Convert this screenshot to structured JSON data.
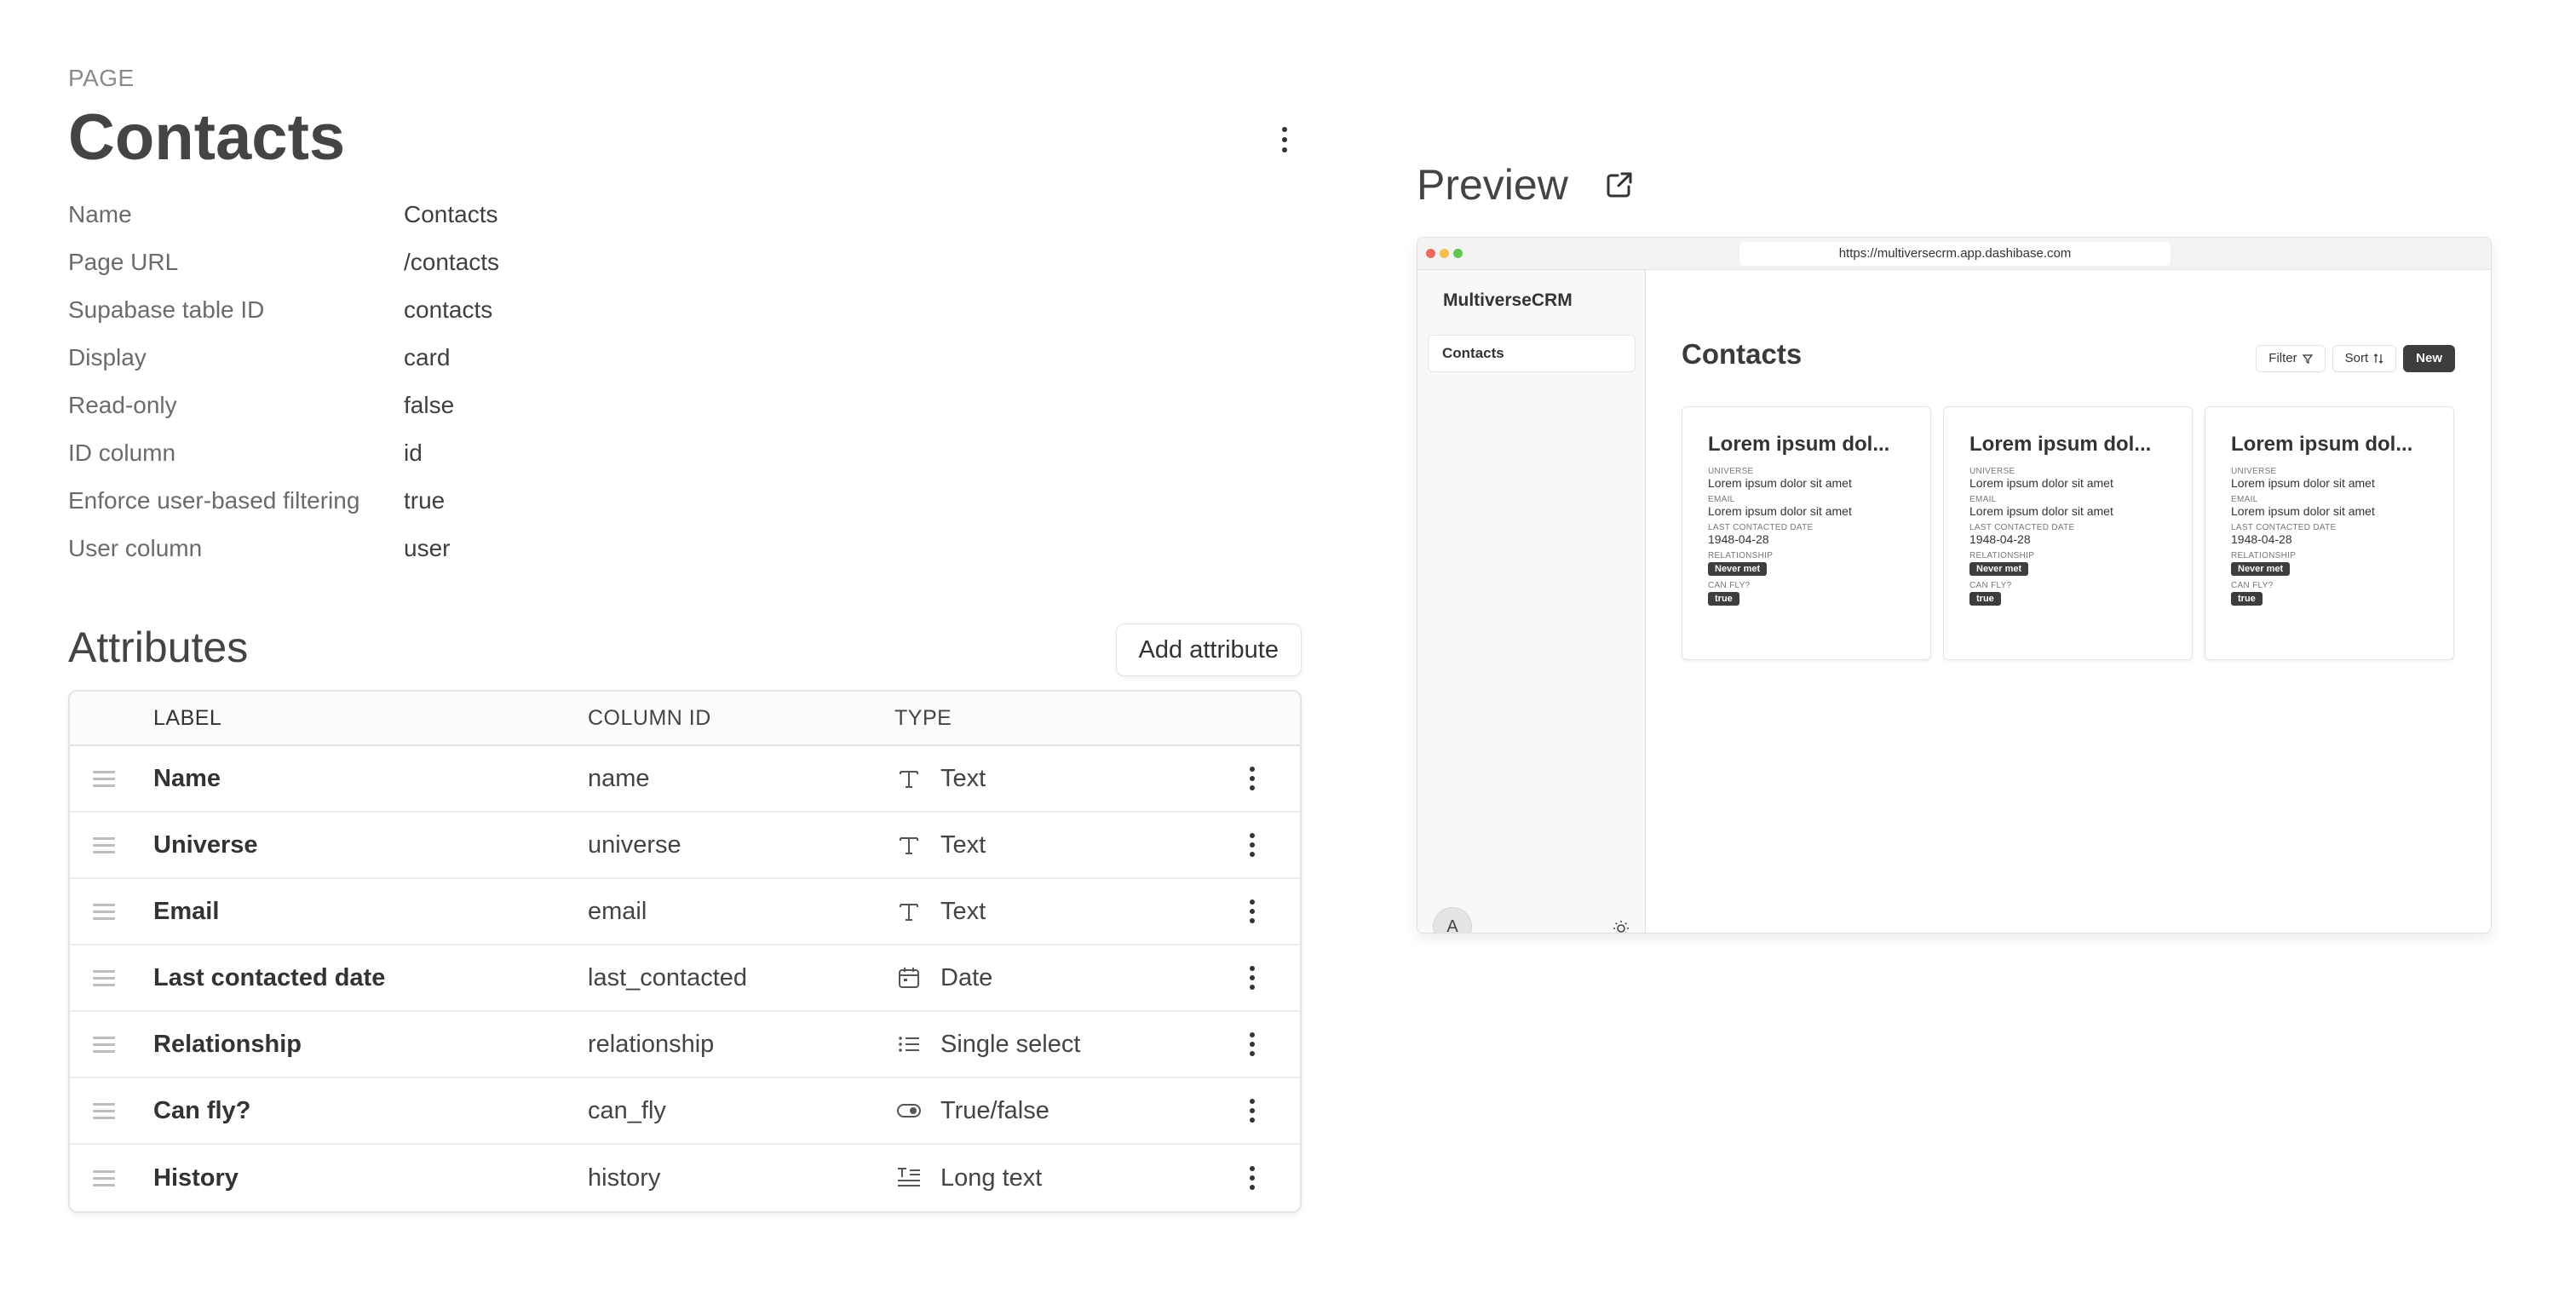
{
  "page": {
    "eyebrow": "PAGE",
    "title": "Contacts"
  },
  "properties": [
    {
      "key": "Name",
      "value": "Contacts"
    },
    {
      "key": "Page URL",
      "value": "/contacts"
    },
    {
      "key": "Supabase table ID",
      "value": "contacts"
    },
    {
      "key": "Display",
      "value": "card"
    },
    {
      "key": "Read-only",
      "value": "false"
    },
    {
      "key": "ID column",
      "value": "id"
    },
    {
      "key": "Enforce user-based filtering",
      "value": "true"
    },
    {
      "key": "User column",
      "value": "user"
    }
  ],
  "attributes": {
    "title": "Attributes",
    "add_label": "Add attribute",
    "columns": {
      "label": "LABEL",
      "column_id": "COLUMN ID",
      "type": "TYPE"
    },
    "rows": [
      {
        "label": "Name",
        "column_id": "name",
        "type": "Text",
        "icon": "text-type-icon"
      },
      {
        "label": "Universe",
        "column_id": "universe",
        "type": "Text",
        "icon": "text-type-icon"
      },
      {
        "label": "Email",
        "column_id": "email",
        "type": "Text",
        "icon": "text-type-icon"
      },
      {
        "label": "Last contacted date",
        "column_id": "last_contacted",
        "type": "Date",
        "icon": "calendar-icon"
      },
      {
        "label": "Relationship",
        "column_id": "relationship",
        "type": "Single select",
        "icon": "list-icon"
      },
      {
        "label": "Can fly?",
        "column_id": "can_fly",
        "type": "True/false",
        "icon": "toggle-icon"
      },
      {
        "label": "History",
        "column_id": "history",
        "type": "Long text",
        "icon": "long-text-icon"
      }
    ]
  },
  "preview": {
    "title": "Preview",
    "url": "https://multiversecrm.app.dashibase.com",
    "traffic_lights": [
      "#ed6a5e",
      "#f5bf4f",
      "#61c554"
    ],
    "app_name": "MultiverseCRM",
    "nav_item": "Contacts",
    "avatar_initial": "A",
    "main_title": "Contacts",
    "filter_label": "Filter",
    "sort_label": "Sort",
    "new_label": "New",
    "cards": [
      {
        "title": "Lorem ipsum dol...",
        "fields": [
          {
            "label": "UNIVERSE",
            "value": "Lorem ipsum dolor sit amet"
          },
          {
            "label": "EMAIL",
            "value": "Lorem ipsum dolor sit amet"
          },
          {
            "label": "LAST CONTACTED DATE",
            "value": "1948-04-28"
          }
        ],
        "relationship_label": "RELATIONSHIP",
        "relationship": "Never met",
        "fly_label": "CAN FLY?",
        "fly": "true"
      },
      {
        "title": "Lorem ipsum dol...",
        "fields": [
          {
            "label": "UNIVERSE",
            "value": "Lorem ipsum dolor sit amet"
          },
          {
            "label": "EMAIL",
            "value": "Lorem ipsum dolor sit amet"
          },
          {
            "label": "LAST CONTACTED DATE",
            "value": "1948-04-28"
          }
        ],
        "relationship_label": "RELATIONSHIP",
        "relationship": "Never met",
        "fly_label": "CAN FLY?",
        "fly": "true"
      },
      {
        "title": "Lorem ipsum dol...",
        "fields": [
          {
            "label": "UNIVERSE",
            "value": "Lorem ipsum dolor sit amet"
          },
          {
            "label": "EMAIL",
            "value": "Lorem ipsum dolor sit amet"
          },
          {
            "label": "LAST CONTACTED DATE",
            "value": "1948-04-28"
          }
        ],
        "relationship_label": "RELATIONSHIP",
        "relationship": "Never met",
        "fly_label": "CAN FLY?",
        "fly": "true"
      }
    ]
  }
}
